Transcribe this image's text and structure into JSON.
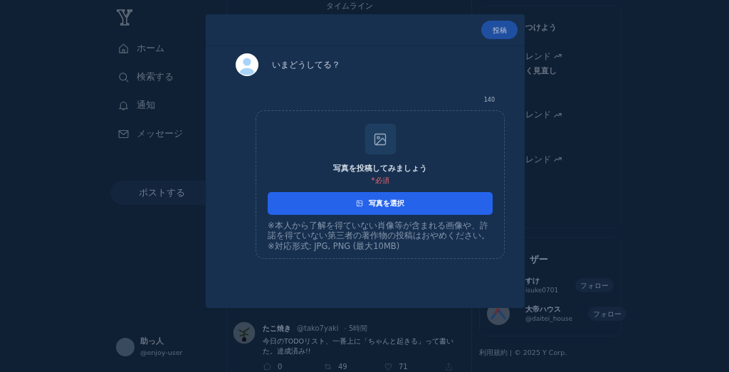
{
  "sidebar": {
    "logo": "Y",
    "items": [
      {
        "kind": "home",
        "label": "ホーム"
      },
      {
        "kind": "search",
        "label": "検索する"
      },
      {
        "kind": "bell",
        "label": "通知"
      },
      {
        "kind": "mail",
        "label": "メッセージ"
      }
    ],
    "post_button": "ポストする",
    "profile": {
      "name": "助っ人",
      "handle": "@enjoy-user"
    }
  },
  "timeline": {
    "title": "タイムライン",
    "posts": [
      {
        "name": "たこ焼き",
        "handle": "@tako7yaki",
        "time": "· 5時間",
        "text": "今日のTODOリスト、一番上に「ちゃんと起きる」って書いた。達成済み!!",
        "replies": "0",
        "reposts": "49",
        "likes": "71"
      }
    ]
  },
  "right": {
    "trends_title": "つけよう",
    "trends": [
      {
        "label": "レンド",
        "topic": "く見直し"
      },
      {
        "label": "レンド"
      },
      {
        "label": "レンド"
      }
    ],
    "users_title": "ザー",
    "users": [
      {
        "name": "すけ",
        "handle": "isuke0701",
        "follow": "フォロー",
        "avatar_visible": false
      },
      {
        "name": "大帝ハウス",
        "handle": "@daitei_house",
        "follow": "フォロー",
        "avatar_visible": true
      }
    ],
    "footer": "利用規約 | © 2025 Y Corp."
  },
  "modal": {
    "post_button": "投稿",
    "placeholder": "いまどうしてる？",
    "counter": "140",
    "upload": {
      "title": "写真を投稿してみましょう",
      "required": "*必須",
      "button": "写真を選択",
      "notes": [
        "※本人から了解を得ていない肖像等が含まれる画像や、許諾を得ていない第三者の著作物の投稿はおやめください。",
        "※対応形式: JPG, PNG (最大10MB)"
      ]
    }
  }
}
